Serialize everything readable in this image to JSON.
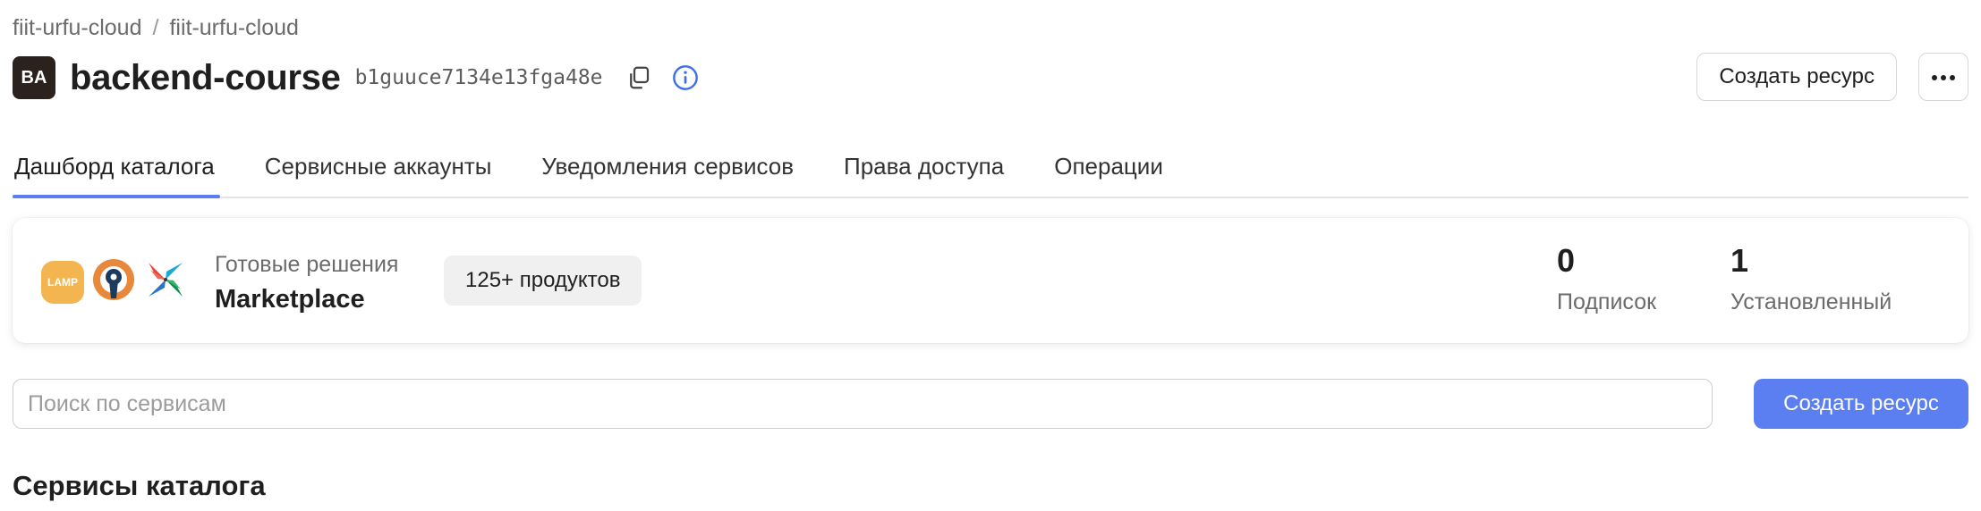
{
  "breadcrumb": {
    "items": [
      "fiit-urfu-cloud",
      "fiit-urfu-cloud"
    ],
    "separator": "/"
  },
  "header": {
    "avatar_initials": "BA",
    "title": "backend-course",
    "id": "b1guuce7134e13fga48e",
    "copy_icon": "copy-icon",
    "info_icon": "info-icon",
    "create_resource_label": "Создать ресурс",
    "more_icon": "ellipsis-icon"
  },
  "tabs": [
    {
      "label": "Дашборд каталога",
      "active": true
    },
    {
      "label": "Сервисные аккаунты",
      "active": false
    },
    {
      "label": "Уведомления сервисов",
      "active": false
    },
    {
      "label": "Права доступа",
      "active": false
    },
    {
      "label": "Операции",
      "active": false
    }
  ],
  "marketplace": {
    "logos": [
      "lamp-logo",
      "openvpn-logo",
      "airflow-logo"
    ],
    "lamp_text": "LAMP",
    "subtitle": "Готовые решения",
    "title": "Marketplace",
    "badge": "125+ продуктов",
    "stats": [
      {
        "value": "0",
        "label": "Подписок"
      },
      {
        "value": "1",
        "label": "Установленный"
      }
    ]
  },
  "search": {
    "placeholder": "Поиск по сервисам",
    "value": "",
    "create_resource_label": "Создать ресурс"
  },
  "section": {
    "title": "Сервисы каталога"
  },
  "colors": {
    "accent": "#5b7ff0",
    "avatar_bg": "#2b211d",
    "lamp_bg": "#f2b54f",
    "openvpn_orange": "#e8883a",
    "openvpn_dark": "#1c3a5e",
    "info_blue": "#3c6ee8"
  }
}
